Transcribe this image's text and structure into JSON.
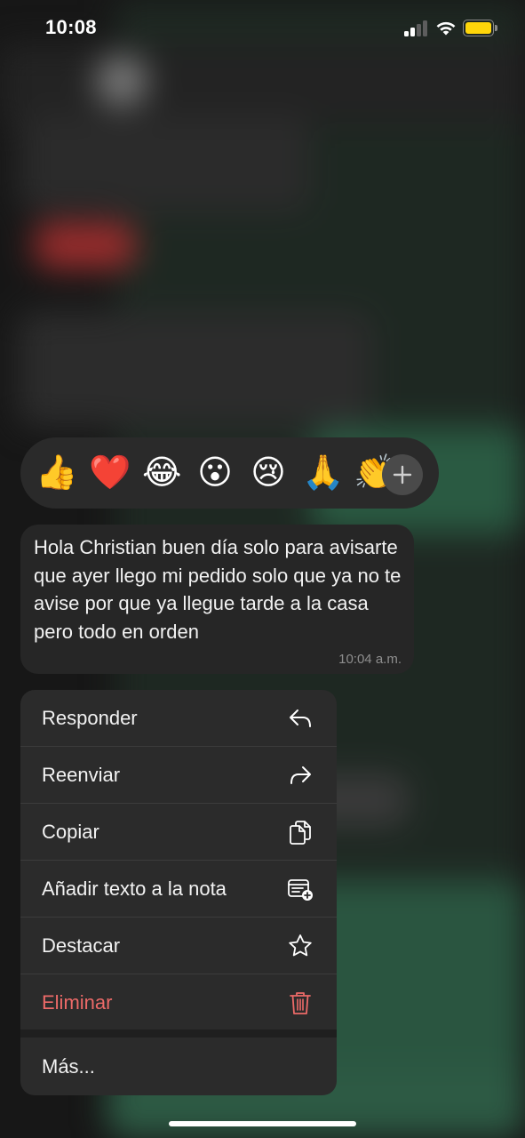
{
  "status_bar": {
    "time": "10:08",
    "signal_bars_filled": 2,
    "signal_bars_total": 4,
    "battery_color": "#ffd60a"
  },
  "reactions": {
    "emojis": [
      {
        "icon": "thumbs-up-icon",
        "glyph": "👍"
      },
      {
        "icon": "red-heart-icon",
        "glyph": "❤️"
      },
      {
        "icon": "tears-of-joy-icon",
        "glyph": "😂"
      },
      {
        "icon": "surprised-face-icon",
        "glyph": "😮"
      },
      {
        "icon": "crying-face-icon",
        "glyph": "😢"
      },
      {
        "icon": "folded-hands-icon",
        "glyph": "🙏"
      },
      {
        "icon": "clapping-hands-icon",
        "glyph": "👏"
      }
    ],
    "more_icon": "plus-icon"
  },
  "message": {
    "text": "Hola Christian buen día solo para avisarte que ayer llego mi pedido solo que ya no te avise por que ya llegue tarde a la casa pero todo en orden",
    "time": "10:04 a.m."
  },
  "menu": {
    "items": [
      {
        "label": "Responder",
        "icon": "reply-icon"
      },
      {
        "label": "Reenviar",
        "icon": "forward-icon"
      },
      {
        "label": "Copiar",
        "icon": "copy-icon"
      },
      {
        "label": "Añadir texto a la nota",
        "icon": "add-to-note-icon"
      },
      {
        "label": "Destacar",
        "icon": "star-icon"
      },
      {
        "label": "Eliminar",
        "icon": "trash-icon"
      }
    ],
    "more_label": "Más...",
    "danger_color": "#ec6a68"
  }
}
